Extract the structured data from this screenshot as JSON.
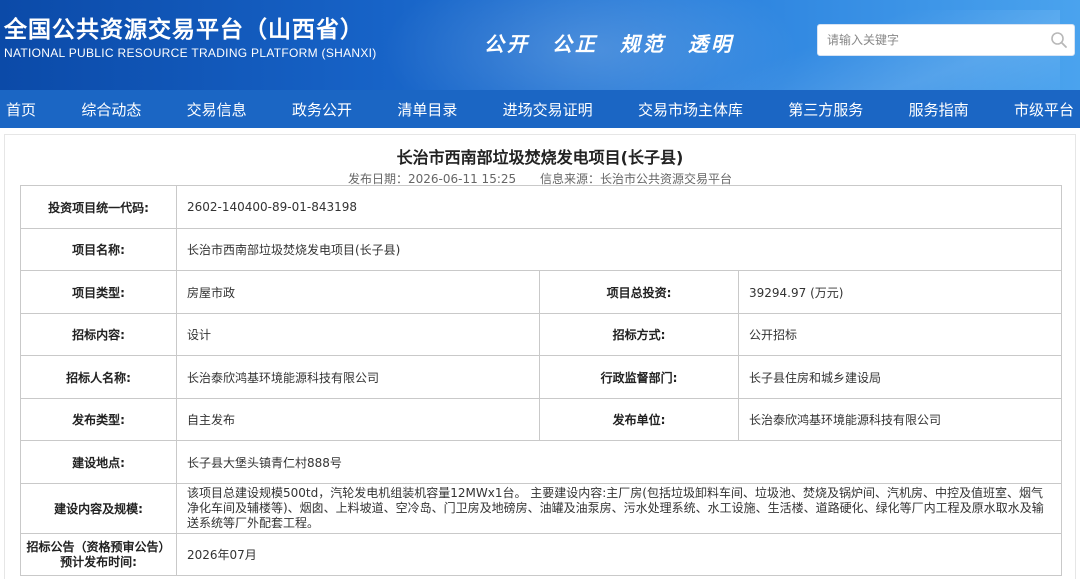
{
  "header": {
    "title_cn": "全国公共资源交易平台（山西省）",
    "title_en": "NATIONAL PUBLIC RESOURCE TRADING PLATFORM (SHANXI)",
    "slogans": [
      "公开",
      "公正",
      "规范",
      "透明"
    ],
    "search_placeholder": "请输入关键字",
    "search_icon": "search-icon"
  },
  "nav": {
    "items": [
      "首页",
      "综合动态",
      "交易信息",
      "政务公开",
      "清单目录",
      "进场交易证明",
      "交易市场主体库",
      "第三方服务",
      "服务指南",
      "市级平台"
    ]
  },
  "article": {
    "title": "长治市西南部垃圾焚烧发电项目(长子县)",
    "publish_date": "发布日期：2026-06-11 15:25",
    "source": "信息来源：长治市公共资源交易平台"
  },
  "table": {
    "project_code_label": "投资项目统一代码:",
    "project_code": "2602-140400-89-01-843198",
    "project_name_label": "项目名称:",
    "project_name": "长治市西南部垃圾焚烧发电项目(长子县)",
    "project_type_label": "项目类型:",
    "project_type": "房屋市政",
    "total_investment_label": "项目总投资:",
    "total_investment": "39294.97 (万元)",
    "bid_content_label": "招标内容:",
    "bid_content": "设计",
    "bid_method_label": "招标方式:",
    "bid_method": "公开招标",
    "tenderer_label": "招标人名称:",
    "tenderer": "长治泰欣鸿基环境能源科技有限公司",
    "supervisor_label": "行政监督部门:",
    "supervisor": "长子县住房和城乡建设局",
    "publish_type_label": "发布类型:",
    "publish_type": "自主发布",
    "publisher_label": "发布单位:",
    "publisher": "长治泰欣鸿基环境能源科技有限公司",
    "location_label": "建设地点:",
    "location": "长子县大堡头镇青仁村888号",
    "scope_label": "建设内容及规模:",
    "scope": "该项目总建设规模500td，汽轮发电机组装机容量12MWx1台。 主要建设内容:主厂房(包括垃圾卸料车间、垃圾池、焚烧及锅炉间、汽机房、中控及值班室、烟气净化车间及辅楼等)、烟囱、上料坡道、空冷岛、门卫房及地磅房、油罐及油泵房、污水处理系统、水工设施、生活楼、道路硬化、绿化等厂内工程及原水取水及输送系统等厂外配套工程。",
    "announce_time_label": "招标公告（资格预审公告）预计发布时间:",
    "announce_time": "2026年07月"
  }
}
